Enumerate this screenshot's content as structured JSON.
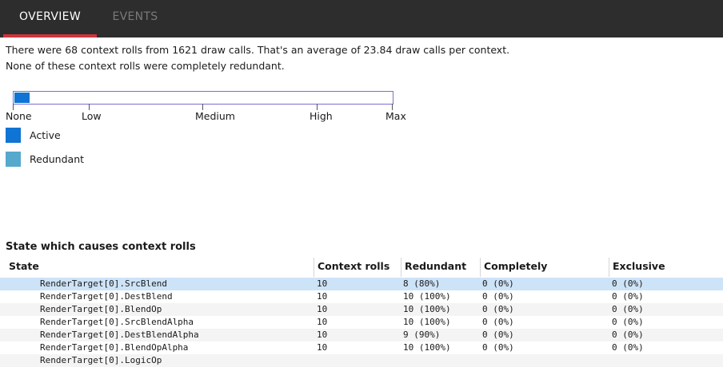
{
  "tabs": [
    {
      "label": "OVERVIEW",
      "active": true
    },
    {
      "label": "EVENTS",
      "active": false
    }
  ],
  "summary": {
    "line1": "There were 68 context rolls from 1621 draw calls. That's an average of 23.84 draw calls per context.",
    "line2": "None of these context rolls were completely redundant."
  },
  "gauge": {
    "fill_fraction": 0.04,
    "fill_color": "#0f74d4",
    "labels": [
      "None",
      "Low",
      "Medium",
      "High",
      "Max"
    ]
  },
  "legend": [
    {
      "label": "Active",
      "color": "#0f74d4"
    },
    {
      "label": "Redundant",
      "color": "#56a8cc"
    }
  ],
  "table": {
    "title": "State which causes context rolls",
    "headers": [
      "State",
      "Context rolls",
      "Redundant",
      "Completely redundant",
      "Exclusive"
    ],
    "rows": [
      [
        "RenderTarget[0].SrcBlend",
        "10",
        "8 (80%)",
        "0 (0%)",
        "0 (0%)"
      ],
      [
        "RenderTarget[0].DestBlend",
        "10",
        "10 (100%)",
        "0 (0%)",
        "0 (0%)"
      ],
      [
        "RenderTarget[0].BlendOp",
        "10",
        "10 (100%)",
        "0 (0%)",
        "0 (0%)"
      ],
      [
        "RenderTarget[0].SrcBlendAlpha",
        "10",
        "10 (100%)",
        "0 (0%)",
        "0 (0%)"
      ],
      [
        "RenderTarget[0].DestBlendAlpha",
        "10",
        "9 (90%)",
        "0 (0%)",
        "0 (0%)"
      ],
      [
        "RenderTarget[0].BlendOpAlpha",
        "10",
        "10 (100%)",
        "0 (0%)",
        "0 (0%)"
      ],
      [
        "RenderTarget[0].LogicOp",
        "",
        "",
        "",
        ""
      ]
    ],
    "selected_row": 0
  }
}
